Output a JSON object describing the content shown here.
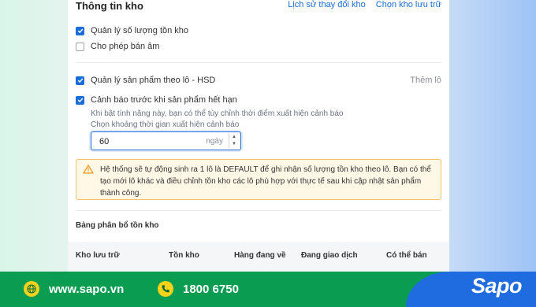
{
  "section": {
    "title": "Thông tin kho",
    "links": [
      "Lịch sử thay đổi kho",
      "Chọn kho lưu trữ"
    ]
  },
  "options": {
    "manage_stock": {
      "label": "Quản lý số lượng tồn kho",
      "checked": true
    },
    "allow_negative": {
      "label": "Cho phép bán âm",
      "checked": false
    },
    "manage_lots": {
      "label": "Quản lý sản phẩm theo lô - HSD",
      "checked": true
    },
    "add_lot_label": "Thêm lô",
    "expiry_warning": {
      "label": "Cảnh báo trước khi sản phẩm hết hạn",
      "checked": true
    }
  },
  "hint": {
    "description": "Khi bật tính năng này, bạn có thể tùy chỉnh thời điểm xuất hiện cảnh báo",
    "prompt": "Chọn khoảng thời gian xuất hiện cảnh báo"
  },
  "warning_days": {
    "value": "60",
    "unit": "ngày"
  },
  "alert": {
    "text": "Hệ thống sẽ tự động sinh ra 1 lô là DEFAULT để ghi nhận số lượng tồn kho theo lô. Bạn có thể tạo mới lô khác và điều chỉnh tồn kho các lô phù hợp với thực tế sau khi cập nhật sản phẩm thành công."
  },
  "distribution": {
    "title": "Bảng phân bổ tồn kho",
    "columns": [
      "Kho lưu trữ",
      "Tồn kho",
      "Hàng đang về",
      "Đang giao dịch",
      "Có thể bán"
    ]
  },
  "footer": {
    "website": "www.sapo.vn",
    "phone": "1800 6750",
    "logo": "Sapo"
  },
  "colors": {
    "accent": "#1a6dd8",
    "footer_green": "#0a9d52",
    "footer_blue": "#1f6be0",
    "warning_border": "#f5c26b",
    "warning_bg": "#fff8e6"
  }
}
